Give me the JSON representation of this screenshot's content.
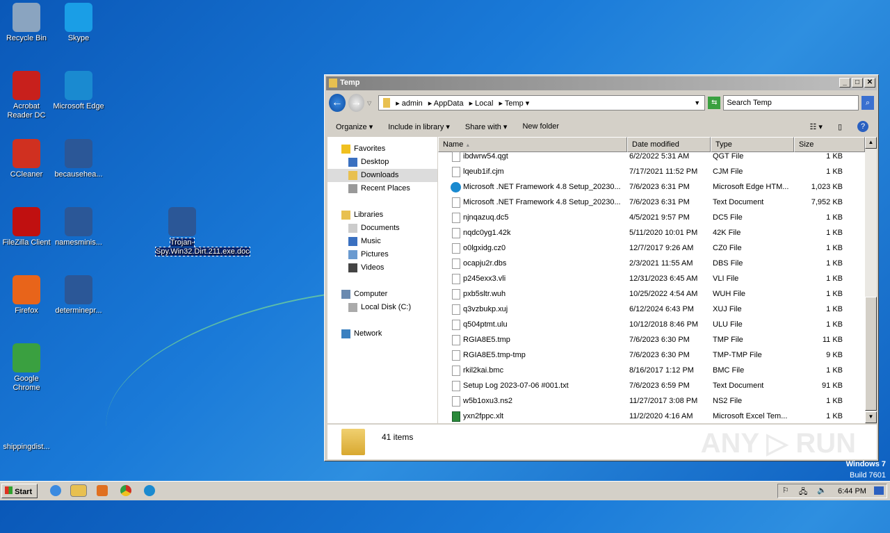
{
  "desktop": {
    "icons": [
      {
        "label": "Recycle Bin",
        "color": "#8aa4c0"
      },
      {
        "label": "Skype",
        "color": "#1a9ee6"
      },
      {
        "label": "Acrobat Reader DC",
        "color": "#c8201c"
      },
      {
        "label": "Microsoft Edge",
        "color": "#1a8ad0"
      },
      {
        "label": "CCleaner",
        "color": "#d03020"
      },
      {
        "label": "becausehea...",
        "color": "#2b5797"
      },
      {
        "label": "FileZilla Client",
        "color": "#c01010"
      },
      {
        "label": "namesminis...",
        "color": "#2b5797"
      },
      {
        "label": "Firefox",
        "color": "#e8641a"
      },
      {
        "label": "determinepr...",
        "color": "#2b5797"
      },
      {
        "label": "Google Chrome",
        "color": "#3aa040"
      },
      {
        "label": "shippingdist...",
        "color": "#1a6ad0"
      },
      {
        "label": "Trojan-Spy.Win32.Dirt.211.exe.doc",
        "color": "#2b5797"
      }
    ]
  },
  "window": {
    "title": "Temp",
    "breadcrumb": [
      "admin",
      "AppData",
      "Local",
      "Temp"
    ],
    "search_placeholder": "Search Temp",
    "toolbar": {
      "organize": "Organize",
      "include": "Include in library",
      "share": "Share with",
      "new_folder": "New folder"
    },
    "nav": {
      "favorites": "Favorites",
      "desktop": "Desktop",
      "downloads": "Downloads",
      "recent": "Recent Places",
      "libraries": "Libraries",
      "documents": "Documents",
      "music": "Music",
      "pictures": "Pictures",
      "videos": "Videos",
      "computer": "Computer",
      "local_disk": "Local Disk (C:)",
      "network": "Network"
    },
    "columns": {
      "name": "Name",
      "date": "Date modified",
      "type": "Type",
      "size": "Size"
    },
    "files": [
      {
        "name": "ibdwrw54.qgt",
        "date": "6/2/2022 5:31 AM",
        "type": "QGT File",
        "size": "1 KB"
      },
      {
        "name": "lqeub1if.cjm",
        "date": "7/17/2021 11:52 PM",
        "type": "CJM File",
        "size": "1 KB"
      },
      {
        "name": "Microsoft .NET Framework 4.8 Setup_20230...",
        "date": "7/6/2023 6:31 PM",
        "type": "Microsoft Edge HTM...",
        "size": "1,023 KB",
        "icon": "edge"
      },
      {
        "name": "Microsoft .NET Framework 4.8 Setup_20230...",
        "date": "7/6/2023 6:31 PM",
        "type": "Text Document",
        "size": "7,952 KB"
      },
      {
        "name": "njnqazuq.dc5",
        "date": "4/5/2021 9:57 PM",
        "type": "DC5 File",
        "size": "1 KB"
      },
      {
        "name": "nqdc0yg1.42k",
        "date": "5/11/2020 10:01 PM",
        "type": "42K File",
        "size": "1 KB"
      },
      {
        "name": "o0lgxidg.cz0",
        "date": "12/7/2017 9:26 AM",
        "type": "CZ0 File",
        "size": "1 KB"
      },
      {
        "name": "ocapju2r.dbs",
        "date": "2/3/2021 11:55 AM",
        "type": "DBS File",
        "size": "1 KB"
      },
      {
        "name": "p245exx3.vli",
        "date": "12/31/2023 6:45 AM",
        "type": "VLI File",
        "size": "1 KB"
      },
      {
        "name": "pxb5sltr.wuh",
        "date": "10/25/2022 4:54 AM",
        "type": "WUH File",
        "size": "1 KB"
      },
      {
        "name": "q3vzbukp.xuj",
        "date": "6/12/2024 6:43 PM",
        "type": "XUJ File",
        "size": "1 KB"
      },
      {
        "name": "q504ptmt.ulu",
        "date": "10/12/2018 8:46 PM",
        "type": "ULU File",
        "size": "1 KB"
      },
      {
        "name": "RGIA8E5.tmp",
        "date": "7/6/2023 6:30 PM",
        "type": "TMP File",
        "size": "11 KB"
      },
      {
        "name": "RGIA8E5.tmp-tmp",
        "date": "7/6/2023 6:30 PM",
        "type": "TMP-TMP File",
        "size": "9 KB"
      },
      {
        "name": "rkil2kai.bmc",
        "date": "8/16/2017 1:12 PM",
        "type": "BMC File",
        "size": "1 KB"
      },
      {
        "name": "Setup Log 2023-07-06 #001.txt",
        "date": "7/6/2023 6:59 PM",
        "type": "Text Document",
        "size": "91 KB"
      },
      {
        "name": "w5b1oxu3.ns2",
        "date": "11/27/2017 3:08 PM",
        "type": "NS2 File",
        "size": "1 KB"
      },
      {
        "name": "yxn2fppc.xlt",
        "date": "11/2/2020 4:16 AM",
        "type": "Microsoft Excel Tem...",
        "size": "1 KB",
        "icon": "excel"
      }
    ],
    "status": "41 items"
  },
  "watermark": {
    "brand": "ANY RUN",
    "line1": "Windows 7",
    "line2": "Build 7601"
  },
  "taskbar": {
    "start": "Start",
    "clock": "6:44 PM"
  }
}
